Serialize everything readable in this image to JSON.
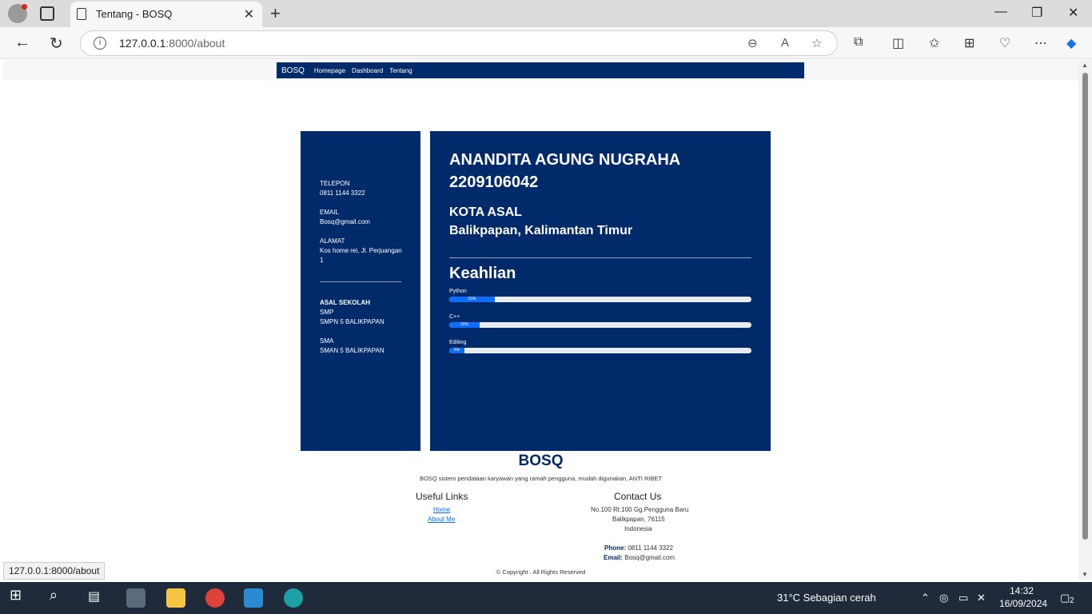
{
  "browser": {
    "tab_title": "Tentang - BOSQ",
    "url_host": "127.0.0.1",
    "url_path": ":8000/about",
    "status_url": "127.0.0.1:8000/about"
  },
  "site": {
    "nav": {
      "brand": "BOSQ",
      "links": [
        "Homepage",
        "Dashboard",
        "Tentang"
      ]
    },
    "left": {
      "telepon_label": "TELEPON",
      "telepon": "0811 1144 3322",
      "email_label": "EMAIL",
      "email": "Bosq@gmail.com",
      "alamat_label": "ALAMAT",
      "alamat_1": "Kos home rei, Jl. Perjuangan",
      "alamat_2": "1",
      "sekolah_label": "ASAL SEKOLAH",
      "smp_label": "SMP",
      "smp": "SMPN 5 BALIKPAPAN",
      "sma_label": "SMA",
      "sma": "SMAN 5 BALIKPAPAN"
    },
    "right": {
      "name": "ANANDITA AGUNG NUGRAHA",
      "nim": "2209106042",
      "kota_label": "KOTA ASAL",
      "kota": "Balikpapan, Kalimantan Timur",
      "skills_title": "Keahlian",
      "skills": [
        {
          "name": "Python",
          "label": "15%",
          "value": 15
        },
        {
          "name": "C++",
          "label": "10%",
          "value": 10
        },
        {
          "name": "Editing",
          "label": "5%",
          "value": 5
        }
      ]
    },
    "footer": {
      "brand": "BOSQ",
      "tagline": "BOSQ sistem pendataan karyawan yang ramah pengguna, mudah digunakan, ANTI RIBET",
      "links_title": "Useful Links",
      "links": [
        "Home",
        "About Me"
      ],
      "contact_title": "Contact Us",
      "address_1": "No.100 Rt.100 Gg.Pengguna Baru",
      "address_2": "Balikpapan, 76115",
      "address_3": "Indonesia",
      "phone_label": "Phone:",
      "phone": "0811 1144 3322",
      "email_label": "Email:",
      "email": "Bosq@gmail.com",
      "copyright": "© Copyright . All Rights Reserved"
    }
  },
  "taskbar": {
    "weather": "31°C  Sebagian cerah",
    "time": "14:32",
    "date": "16/09/2024",
    "notifications": "2"
  }
}
